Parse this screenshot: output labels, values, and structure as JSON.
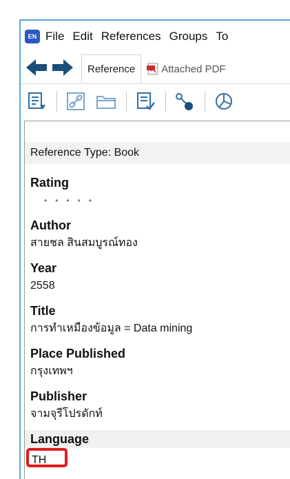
{
  "app": {
    "logo_text": "EN"
  },
  "menu": [
    "File",
    "Edit",
    "References",
    "Groups",
    "To"
  ],
  "tabs": {
    "reference": "Reference",
    "attached_pdf": "Attached PDF"
  },
  "toolbar_icons": [
    "insert-citation-icon",
    "link-icon",
    "folder-icon",
    "format-bibliography-icon",
    "find-fulltext-icon",
    "chart-icon"
  ],
  "reference": {
    "type_label": "Reference Type:",
    "type_value": "Book",
    "fields": {
      "rating_label": "Rating",
      "rating_dots": "•••••",
      "author_label": "Author",
      "author_value": "สายชล สินสมบูรณ์ทอง",
      "year_label": "Year",
      "year_value": "2558",
      "title_label": "Title",
      "title_value": "การทำเหมืองข้อมูล = Data mining",
      "place_label": "Place Published",
      "place_value": "กรุงเทพฯ",
      "publisher_label": "Publisher",
      "publisher_value": "จามจุรีโปรดักท์",
      "language_label": "Language",
      "language_value": "TH"
    }
  },
  "colors": {
    "window_border": "#5aa7d8",
    "nav_arrow": "#1a4f7a",
    "icon_blue": "#2b6ea8",
    "highlight_red": "#e01b1b"
  }
}
